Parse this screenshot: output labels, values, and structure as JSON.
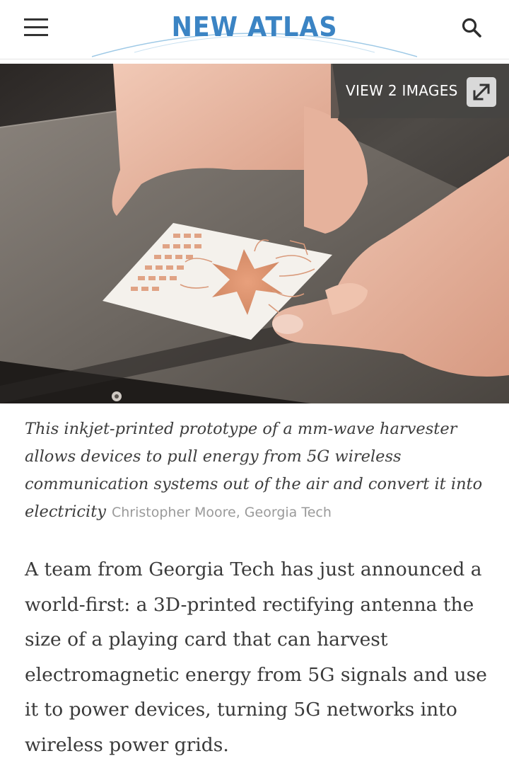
{
  "header": {
    "logo_text": "NEW ATLAS",
    "menu_icon": "hamburger-menu-icon",
    "search_icon": "search-icon",
    "logo_color": "#3b84c4"
  },
  "hero": {
    "view_images_label": "VIEW 2 IMAGES",
    "expand_icon": "expand-icon",
    "image_description_alt": "inkjet-printed prototype of a mm-wave harvester"
  },
  "caption": {
    "text": "This inkjet-printed prototype of a mm-wave harvester allows devices to pull energy from 5G wireless communication systems out of the air and convert it into electricity",
    "credit": "Christopher Moore, Georgia Tech"
  },
  "article": {
    "paragraph_1": "A team from Georgia Tech has just announced a world-first: a 3D-printed rectifying antenna the size of a playing card that can harvest electromagnetic energy from 5G signals and use it to power devices, turning 5G networks into wireless power grids."
  }
}
